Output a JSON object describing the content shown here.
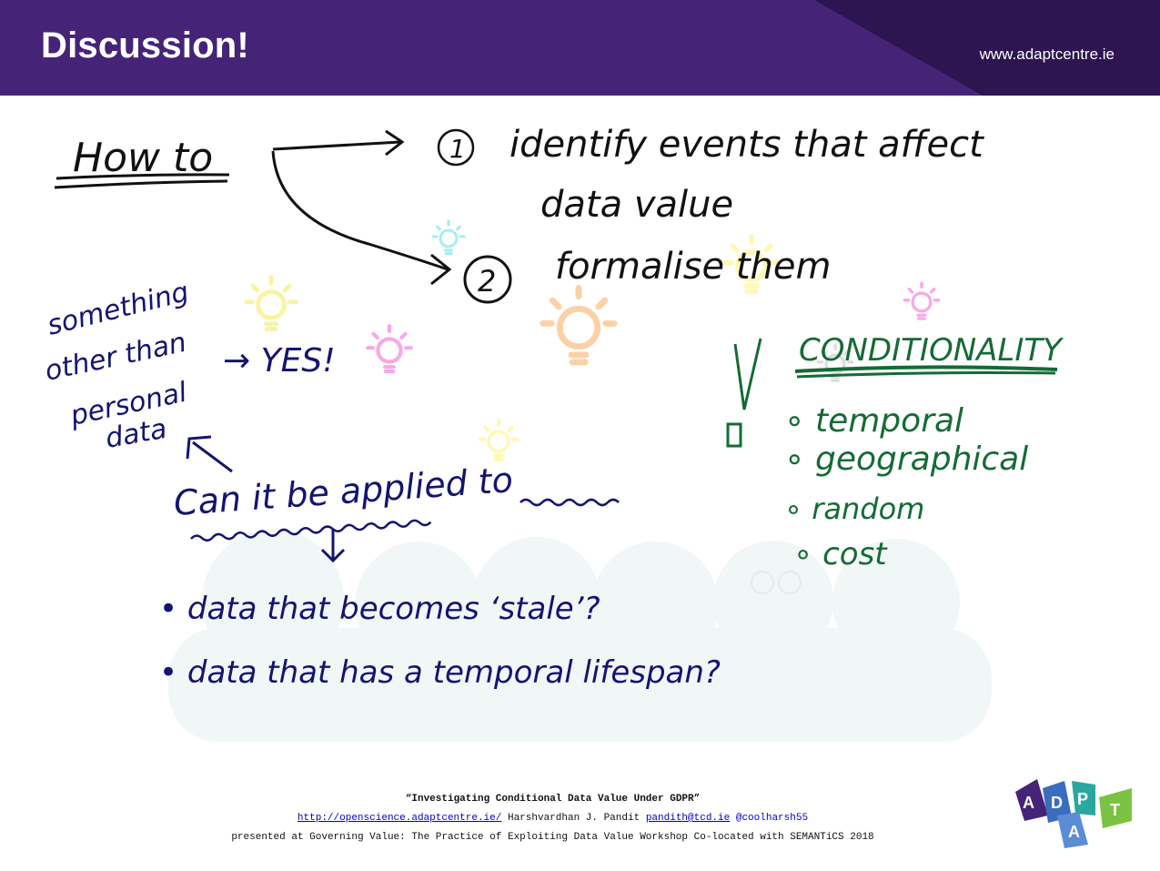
{
  "header": {
    "title": "Discussion!",
    "url": "www.adaptcentre.ie",
    "colors": {
      "bar": "#452478",
      "accent": "#2c1550"
    }
  },
  "notes": {
    "how_to": "How to",
    "item1_marker": "1",
    "item1_line1": "identify events that affect",
    "item1_line2": "data value",
    "item2_marker": "2",
    "item2_text": "formalise them",
    "something_line1": "something",
    "something_line2": "other than",
    "something_line3": "personal",
    "something_line4": "data",
    "yes": "→ YES!",
    "applied": "Can it be applied to",
    "bullet1": "• data that becomes ‘stale’?",
    "bullet2": "• data that has a temporal lifespan?",
    "exclaim": "!",
    "conditionality": "CONDITIONALITY",
    "cond_items": [
      "∘ temporal",
      "∘ geographical",
      "∘ random",
      "∘ cost"
    ],
    "ink_colors": {
      "black": "#111111",
      "blue": "#141470",
      "green": "#146b35"
    }
  },
  "decorations": {
    "icons": [
      "lightbulb-icon",
      "people-silhouette"
    ],
    "bulb_colors": [
      "#a8ecf0",
      "#faf3a0",
      "#f9a8e6",
      "#fbd2a8",
      "#fff8b0",
      "#dddddd"
    ]
  },
  "footer": {
    "title": "“Investigating Conditional Data Value Under GDPR”",
    "link": "http://openscience.adaptcentre.ie/",
    "author": "Harshvardhan J. Pandit",
    "email": "pandith@tcd.ie",
    "handle": "@coolharsh55",
    "venue": "presented at Governing Value: The Practice of Exploiting Data Value Workshop Co-located with SEMANTiCS 2018"
  },
  "logo": {
    "letters": [
      "A",
      "D",
      "A",
      "P",
      "T"
    ],
    "colors": [
      "#452478",
      "#3a6cc0",
      "#5c8cd6",
      "#2aa8a0",
      "#7cc242"
    ]
  }
}
